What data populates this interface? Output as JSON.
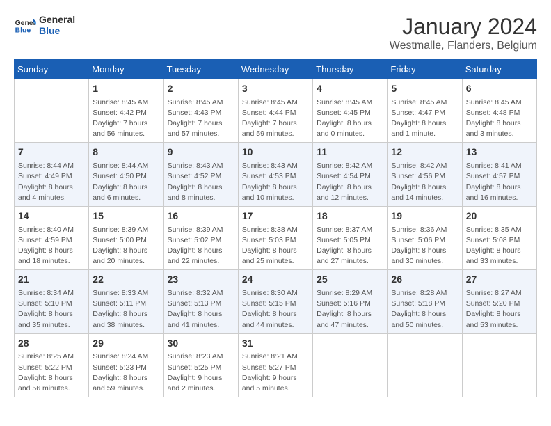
{
  "logo": {
    "text_general": "General",
    "text_blue": "Blue"
  },
  "header": {
    "title": "January 2024",
    "subtitle": "Westmalle, Flanders, Belgium"
  },
  "days_of_week": [
    "Sunday",
    "Monday",
    "Tuesday",
    "Wednesday",
    "Thursday",
    "Friday",
    "Saturday"
  ],
  "weeks": [
    [
      {
        "day": "",
        "info": ""
      },
      {
        "day": "1",
        "info": "Sunrise: 8:45 AM\nSunset: 4:42 PM\nDaylight: 7 hours\nand 56 minutes."
      },
      {
        "day": "2",
        "info": "Sunrise: 8:45 AM\nSunset: 4:43 PM\nDaylight: 7 hours\nand 57 minutes."
      },
      {
        "day": "3",
        "info": "Sunrise: 8:45 AM\nSunset: 4:44 PM\nDaylight: 7 hours\nand 59 minutes."
      },
      {
        "day": "4",
        "info": "Sunrise: 8:45 AM\nSunset: 4:45 PM\nDaylight: 8 hours\nand 0 minutes."
      },
      {
        "day": "5",
        "info": "Sunrise: 8:45 AM\nSunset: 4:47 PM\nDaylight: 8 hours\nand 1 minute."
      },
      {
        "day": "6",
        "info": "Sunrise: 8:45 AM\nSunset: 4:48 PM\nDaylight: 8 hours\nand 3 minutes."
      }
    ],
    [
      {
        "day": "7",
        "info": "Sunrise: 8:44 AM\nSunset: 4:49 PM\nDaylight: 8 hours\nand 4 minutes."
      },
      {
        "day": "8",
        "info": "Sunrise: 8:44 AM\nSunset: 4:50 PM\nDaylight: 8 hours\nand 6 minutes."
      },
      {
        "day": "9",
        "info": "Sunrise: 8:43 AM\nSunset: 4:52 PM\nDaylight: 8 hours\nand 8 minutes."
      },
      {
        "day": "10",
        "info": "Sunrise: 8:43 AM\nSunset: 4:53 PM\nDaylight: 8 hours\nand 10 minutes."
      },
      {
        "day": "11",
        "info": "Sunrise: 8:42 AM\nSunset: 4:54 PM\nDaylight: 8 hours\nand 12 minutes."
      },
      {
        "day": "12",
        "info": "Sunrise: 8:42 AM\nSunset: 4:56 PM\nDaylight: 8 hours\nand 14 minutes."
      },
      {
        "day": "13",
        "info": "Sunrise: 8:41 AM\nSunset: 4:57 PM\nDaylight: 8 hours\nand 16 minutes."
      }
    ],
    [
      {
        "day": "14",
        "info": "Sunrise: 8:40 AM\nSunset: 4:59 PM\nDaylight: 8 hours\nand 18 minutes."
      },
      {
        "day": "15",
        "info": "Sunrise: 8:39 AM\nSunset: 5:00 PM\nDaylight: 8 hours\nand 20 minutes."
      },
      {
        "day": "16",
        "info": "Sunrise: 8:39 AM\nSunset: 5:02 PM\nDaylight: 8 hours\nand 22 minutes."
      },
      {
        "day": "17",
        "info": "Sunrise: 8:38 AM\nSunset: 5:03 PM\nDaylight: 8 hours\nand 25 minutes."
      },
      {
        "day": "18",
        "info": "Sunrise: 8:37 AM\nSunset: 5:05 PM\nDaylight: 8 hours\nand 27 minutes."
      },
      {
        "day": "19",
        "info": "Sunrise: 8:36 AM\nSunset: 5:06 PM\nDaylight: 8 hours\nand 30 minutes."
      },
      {
        "day": "20",
        "info": "Sunrise: 8:35 AM\nSunset: 5:08 PM\nDaylight: 8 hours\nand 33 minutes."
      }
    ],
    [
      {
        "day": "21",
        "info": "Sunrise: 8:34 AM\nSunset: 5:10 PM\nDaylight: 8 hours\nand 35 minutes."
      },
      {
        "day": "22",
        "info": "Sunrise: 8:33 AM\nSunset: 5:11 PM\nDaylight: 8 hours\nand 38 minutes."
      },
      {
        "day": "23",
        "info": "Sunrise: 8:32 AM\nSunset: 5:13 PM\nDaylight: 8 hours\nand 41 minutes."
      },
      {
        "day": "24",
        "info": "Sunrise: 8:30 AM\nSunset: 5:15 PM\nDaylight: 8 hours\nand 44 minutes."
      },
      {
        "day": "25",
        "info": "Sunrise: 8:29 AM\nSunset: 5:16 PM\nDaylight: 8 hours\nand 47 minutes."
      },
      {
        "day": "26",
        "info": "Sunrise: 8:28 AM\nSunset: 5:18 PM\nDaylight: 8 hours\nand 50 minutes."
      },
      {
        "day": "27",
        "info": "Sunrise: 8:27 AM\nSunset: 5:20 PM\nDaylight: 8 hours\nand 53 minutes."
      }
    ],
    [
      {
        "day": "28",
        "info": "Sunrise: 8:25 AM\nSunset: 5:22 PM\nDaylight: 8 hours\nand 56 minutes."
      },
      {
        "day": "29",
        "info": "Sunrise: 8:24 AM\nSunset: 5:23 PM\nDaylight: 8 hours\nand 59 minutes."
      },
      {
        "day": "30",
        "info": "Sunrise: 8:23 AM\nSunset: 5:25 PM\nDaylight: 9 hours\nand 2 minutes."
      },
      {
        "day": "31",
        "info": "Sunrise: 8:21 AM\nSunset: 5:27 PM\nDaylight: 9 hours\nand 5 minutes."
      },
      {
        "day": "",
        "info": ""
      },
      {
        "day": "",
        "info": ""
      },
      {
        "day": "",
        "info": ""
      }
    ]
  ]
}
